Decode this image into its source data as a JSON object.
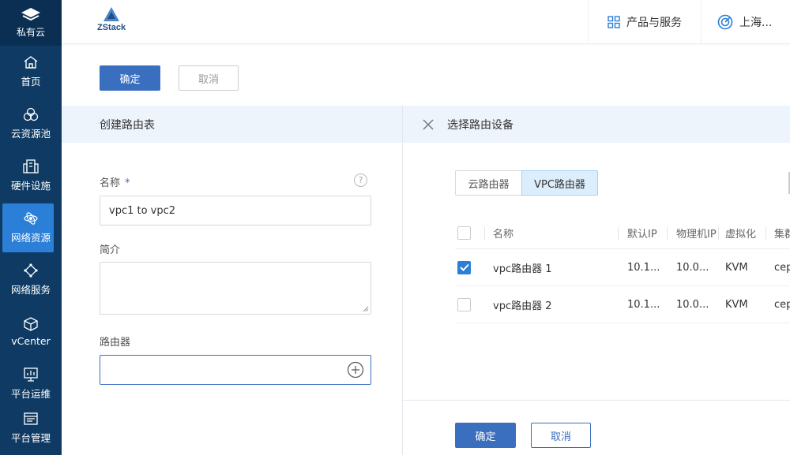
{
  "sidebar": {
    "header": "私有云",
    "items": [
      {
        "label": "首页",
        "icon": "home-icon"
      },
      {
        "label": "云资源池",
        "icon": "resource-pool-icon"
      },
      {
        "label": "硬件设施",
        "icon": "hardware-icon"
      },
      {
        "label": "网络资源",
        "icon": "network-resource-icon",
        "active": true
      },
      {
        "label": "网络服务",
        "icon": "network-service-icon"
      },
      {
        "label": "vCenter",
        "icon": "vcenter-icon"
      },
      {
        "label": "平台运维",
        "icon": "platform-ops-icon"
      },
      {
        "label": "平台管理",
        "icon": "platform-manage-icon"
      }
    ]
  },
  "topbar": {
    "logo_text": "ZStack",
    "products_label": "产品与服务",
    "region_label": "上海..."
  },
  "toolbar": {
    "confirm_label": "确定",
    "cancel_label": "取消"
  },
  "left_panel": {
    "title": "创建路由表",
    "name_label": "名称",
    "required_mark": "*",
    "help_mark": "?",
    "name_value": "vpc1 to vpc2",
    "desc_label": "简介",
    "desc_value": "",
    "router_label": "路由器",
    "router_value": ""
  },
  "right_panel": {
    "title": "选择路由设备",
    "tabs": [
      {
        "label": "云路由器",
        "active": false
      },
      {
        "label": "VPC路由器",
        "active": true
      }
    ],
    "columns": [
      "名称",
      "默认IP",
      "物理机IP",
      "虚拟化",
      "集群"
    ],
    "rows": [
      {
        "checked": true,
        "name": "vpc路由器 1",
        "default_ip": "10.1...",
        "host_ip": "10.0...",
        "hypervisor": "KVM",
        "cluster": "cep"
      },
      {
        "checked": false,
        "name": "vpc路由器 2",
        "default_ip": "10.1...",
        "host_ip": "10.0...",
        "hypervisor": "KVM",
        "cluster": "cep"
      }
    ],
    "confirm_label": "确定",
    "cancel_label": "取消"
  },
  "colors": {
    "sidebar_bg": "#0e3a63",
    "sidebar_active": "#2b7fd6",
    "primary": "#3a6fc0",
    "panel_header_bg": "#eef4fb"
  }
}
